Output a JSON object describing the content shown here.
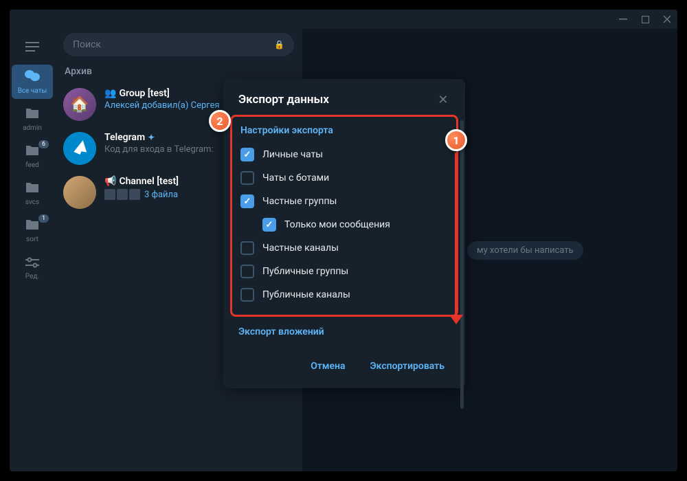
{
  "search": {
    "placeholder": "Поиск"
  },
  "nav": {
    "all_chats": "Все чаты",
    "admin": "admin",
    "feed": "feed",
    "feed_badge": "6",
    "svcs": "svcs",
    "sort": "sort",
    "sort_badge": "1",
    "edit": "Ред."
  },
  "archive": {
    "header": "Архив"
  },
  "chats": [
    {
      "title": "Group [test]",
      "subtitle": "Алексей добавил(а) Сергея"
    },
    {
      "title": "Telegram",
      "subtitle": "Код для входа в Telegram:"
    },
    {
      "title": "Channel [test]",
      "files": "3 файла"
    }
  ],
  "hint": "му хотели бы написать",
  "modal": {
    "title": "Экспорт данных",
    "section_settings": "Настройки экспорта",
    "options": {
      "personal_chats": "Личные чаты",
      "bot_chats": "Чаты с ботами",
      "private_groups": "Частные группы",
      "only_my_messages": "Только мои сообщения",
      "private_channels": "Частные каналы",
      "public_groups": "Публичные группы",
      "public_channels": "Публичные каналы"
    },
    "section_attachments": "Экспорт вложений",
    "cancel": "Отмена",
    "export": "Экспортировать"
  },
  "callouts": {
    "one": "1",
    "two": "2"
  }
}
